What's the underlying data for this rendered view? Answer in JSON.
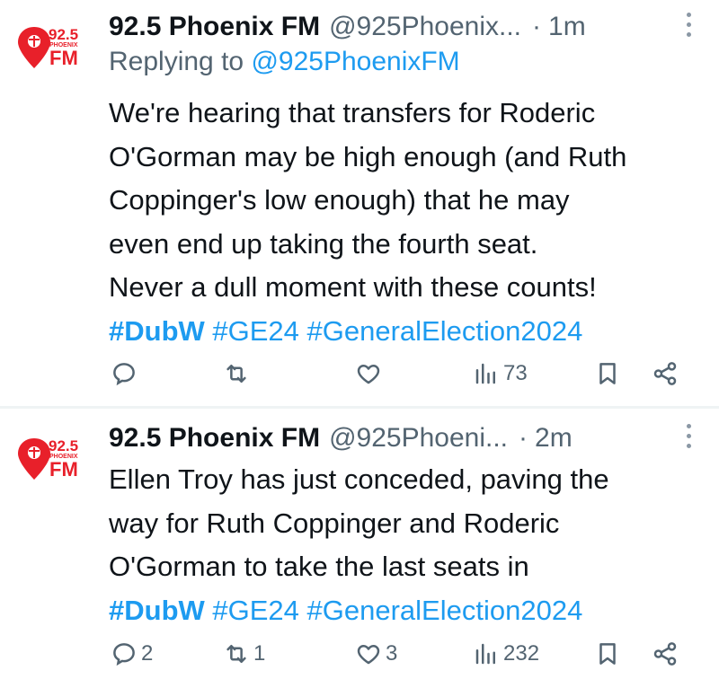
{
  "tweets": [
    {
      "display_name": "92.5 Phoenix FM",
      "handle": "@925Phoenix...",
      "dot": "·",
      "time": "1m",
      "replying_prefix": "Replying to ",
      "replying_to": "@925PhoenixFM",
      "text_lines": [
        "We're hearing that transfers for Roderic",
        "O'Gorman may be high enough (and Ruth",
        "Coppinger's low enough) that he may",
        "even end up taking the fourth seat.",
        "Never a dull moment with these counts!"
      ],
      "hashtags": [
        "#DubW",
        "#GE24",
        "#GeneralElection2024"
      ],
      "replies": "",
      "reposts": "",
      "likes": "",
      "views": "73"
    },
    {
      "display_name": "92.5 Phoenix FM",
      "handle": "@925Phoeni...",
      "dot": "·",
      "time": "2m",
      "text_lines": [
        "Ellen Troy has just conceded, paving the",
        "way for Ruth Coppinger and Roderic",
        "O'Gorman to take the last seats in"
      ],
      "hashtags": [
        "#DubW",
        "#GE24",
        "#GeneralElection2024"
      ],
      "replies": "2",
      "reposts": "1",
      "likes": "3",
      "views": "232"
    }
  ],
  "logo": {
    "number": "92.5",
    "station": "PHOENIX",
    "fm": "FM"
  },
  "colors": {
    "accent": "#1d9bf0",
    "logo_red": "#e8202a",
    "muted": "#536471"
  },
  "icons": [
    "reply-icon",
    "repost-icon",
    "like-icon",
    "views-icon",
    "bookmark-icon",
    "share-icon",
    "more-icon"
  ]
}
